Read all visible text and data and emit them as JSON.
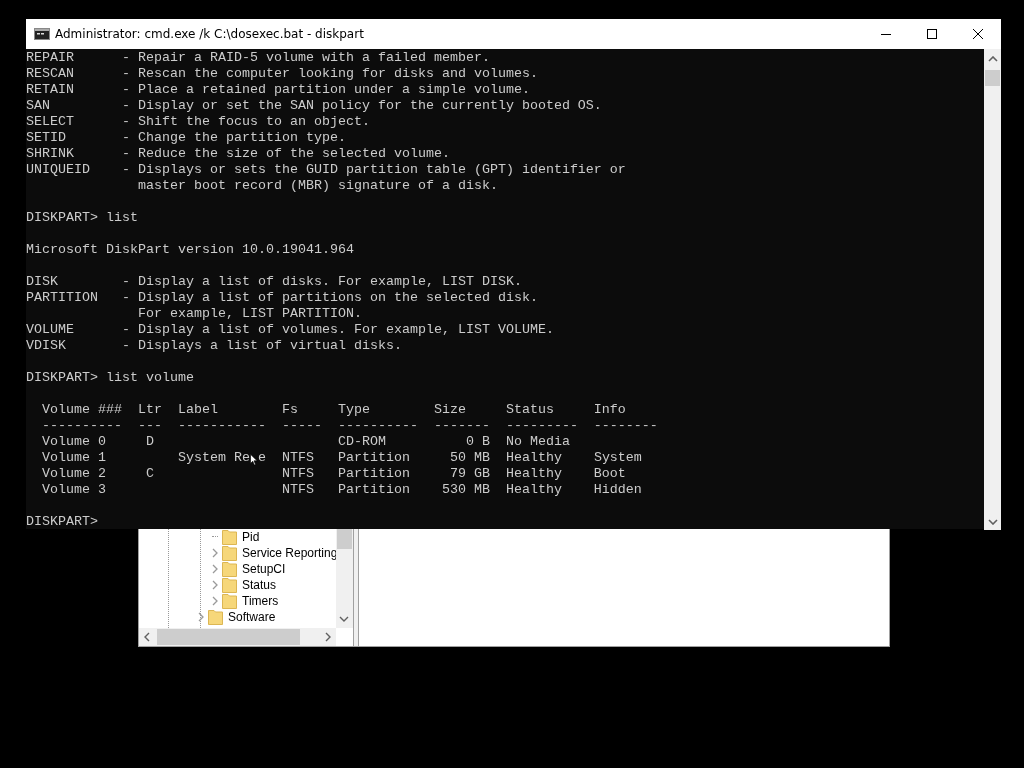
{
  "console_window": {
    "title": "Administrator: cmd.exe /k C:\\dosexec.bat - diskpart",
    "blocks": [
      [
        "REPAIR      - Repair a RAID-5 volume with a failed member.",
        "RESCAN      - Rescan the computer looking for disks and volumes.",
        "RETAIN      - Place a retained partition under a simple volume.",
        "SAN         - Display or set the SAN policy for the currently booted OS.",
        "SELECT      - Shift the focus to an object.",
        "SETID       - Change the partition type.",
        "SHRINK      - Reduce the size of the selected volume.",
        "UNIQUEID    - Displays or sets the GUID partition table (GPT) identifier or",
        "              master boot record (MBR) signature of a disk."
      ],
      [
        "DISKPART> list"
      ],
      [
        "Microsoft DiskPart version 10.0.19041.964"
      ],
      [
        "DISK        - Display a list of disks. For example, LIST DISK.",
        "PARTITION   - Display a list of partitions on the selected disk.",
        "              For example, LIST PARTITION.",
        "VOLUME      - Display a list of volumes. For example, LIST VOLUME.",
        "VDISK       - Displays a list of virtual disks."
      ],
      [
        "DISKPART> list volume"
      ],
      [
        "  Volume ###  Ltr  Label        Fs     Type        Size     Status     Info",
        "  ----------  ---  -----------  -----  ----------  -------  ---------  --------",
        "  Volume 0     D                       CD-ROM          0 B  No Media",
        [
          "  Volume 1         System Re",
          "e  NTFS   Partition     50 MB  Healthy    System"
        ],
        "  Volume 2     C                NTFS   Partition     79 GB  Healthy    Boot",
        "  Volume 3                      NTFS   Partition    530 MB  Healthy    Hidden"
      ],
      [
        "DISKPART>"
      ]
    ]
  },
  "registry_window": {
    "tree": {
      "nested_items": [
        {
          "label": "Pid",
          "expandable": false
        },
        {
          "label": "Service Reporting",
          "expandable": true
        },
        {
          "label": "SetupCI",
          "expandable": true
        },
        {
          "label": "Status",
          "expandable": true
        },
        {
          "label": "Timers",
          "expandable": true
        }
      ],
      "items": [
        {
          "label": "Software",
          "expandable": true
        }
      ]
    }
  }
}
